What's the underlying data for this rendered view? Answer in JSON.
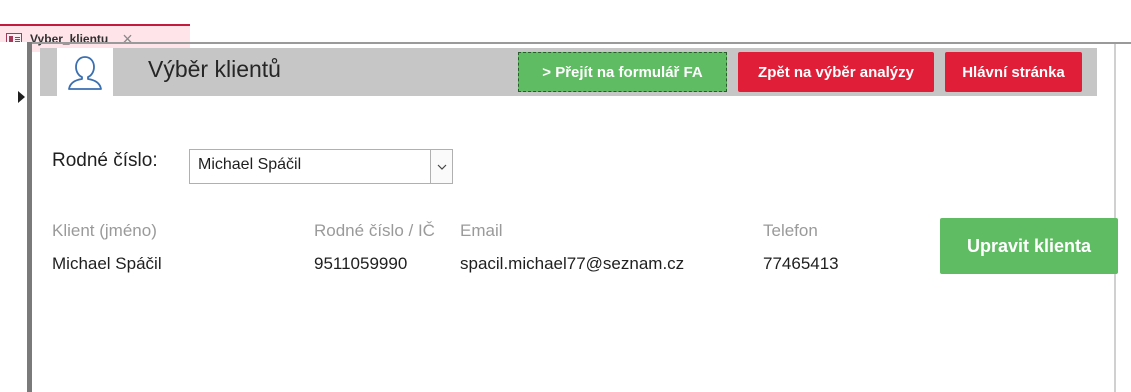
{
  "tab": {
    "title": "Vyber_klientu",
    "close_glyph": "×"
  },
  "header": {
    "title": "Výběr klientů",
    "goto_form_button": "> Přejít na formulář FA",
    "back_button": "Zpět na výběr analýzy",
    "home_button": "Hlávní stránka"
  },
  "selector": {
    "label": "Rodné číslo:",
    "value": "Michael Spáčil"
  },
  "client": {
    "headers": {
      "name": "Klient (jméno)",
      "id": "Rodné číslo / IČ",
      "email": "Email",
      "phone": "Telefon"
    },
    "values": {
      "name": "Michael Spáčil",
      "id": "9511059990",
      "email": "spacil.michael77@seznam.cz",
      "phone": "77465413"
    }
  },
  "edit_button": "Upravit klienta",
  "colors": {
    "tab_accent": "#c21b3d",
    "green": "#5fbc63",
    "red": "#e01e37",
    "header_gray": "#c6c6c6"
  },
  "icons": {
    "tab": "form-icon",
    "avatar": "user-silhouette-icon",
    "dropdown": "chevron-down-icon",
    "record": "record-selector-arrow-icon"
  }
}
